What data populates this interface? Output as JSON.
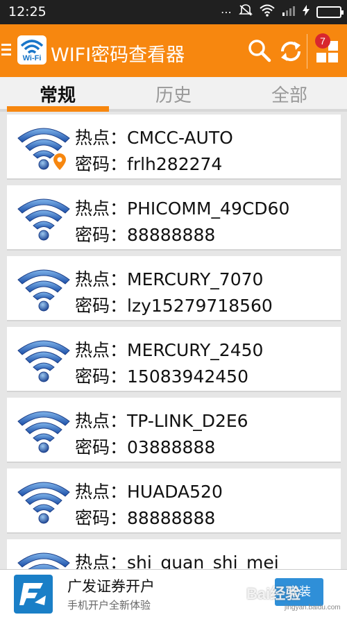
{
  "status_bar": {
    "time": "12:25"
  },
  "app": {
    "title": "WIFI密码查看器",
    "logo_text": "Wi-Fi",
    "notification_count": "7",
    "accent_color": "#f7870f"
  },
  "tabs": [
    {
      "label": "常规",
      "active": true
    },
    {
      "label": "历史",
      "active": false
    },
    {
      "label": "全部",
      "active": false
    }
  ],
  "labels": {
    "hotspot": "热点：",
    "password": "密码："
  },
  "networks": [
    {
      "ssid": "CMCC-AUTO",
      "password": "frlh282274",
      "location_icon": true
    },
    {
      "ssid": "PHICOMM_49CD60",
      "password": "88888888"
    },
    {
      "ssid": "MERCURY_7070",
      "password": "lzy15279718560"
    },
    {
      "ssid": "MERCURY_2450",
      "password": "15083942450"
    },
    {
      "ssid": "TP-LINK_D2E6",
      "password": "03888888"
    },
    {
      "ssid": "HUADA520",
      "password": "88888888"
    },
    {
      "ssid": "shi_quan_shi_mei",
      "password": ""
    }
  ],
  "ad": {
    "title": "广发证券开户",
    "subtitle": "手机开户全新体验",
    "button": "安装"
  },
  "watermark": {
    "text": "Bai经验",
    "sub": "jingyan.baidu.com"
  }
}
